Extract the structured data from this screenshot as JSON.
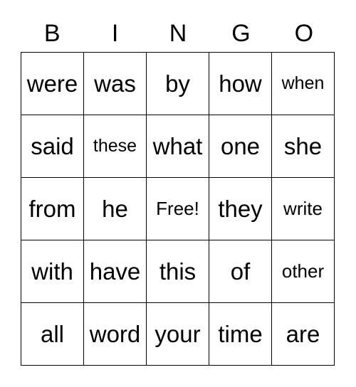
{
  "header": [
    "B",
    "I",
    "N",
    "G",
    "O"
  ],
  "rows": [
    [
      "were",
      "was",
      "by",
      "how",
      "when"
    ],
    [
      "said",
      "these",
      "what",
      "one",
      "she"
    ],
    [
      "from",
      "he",
      "Free!",
      "they",
      "write"
    ],
    [
      "with",
      "have",
      "this",
      "of",
      "other"
    ],
    [
      "all",
      "word",
      "your",
      "time",
      "are"
    ]
  ]
}
